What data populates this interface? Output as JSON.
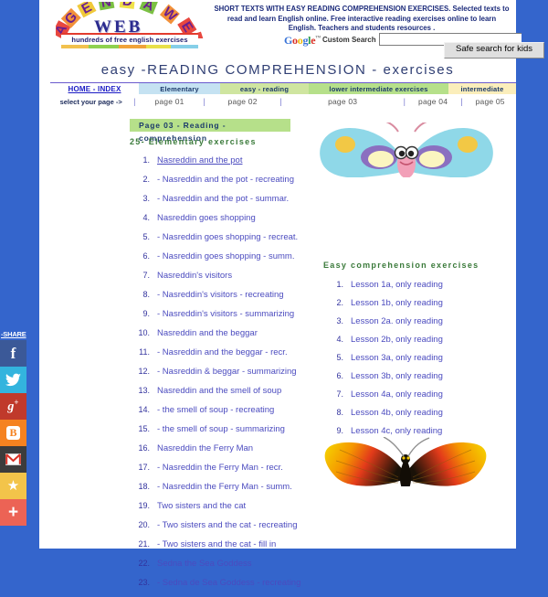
{
  "site": {
    "logo_text": "AGENDA",
    "logo_word": "WEB",
    "logo_tagline": "hundreds of free english exercises"
  },
  "header": {
    "tagline_line1": "SHORT TEXTS WITH EASY READING COMPREHENSION EXERCISES. Selected texts to",
    "tagline_line2": "read and learn English online. Free interactive reading exercises online to learn",
    "tagline_line3": "English. Teachers and students resources .",
    "google_custom_search": "Custom Search",
    "search_value": "",
    "search_placeholder": "",
    "safe_search_button": "Safe search for kids"
  },
  "page_title": "easy -READING COMPREHENSION - exercises",
  "nav": {
    "home_link": "HOME - INDEX",
    "select_label": "select your page ->",
    "separator": "|",
    "tabs": [
      {
        "label": "Elementary",
        "color": "#c5e2f2"
      },
      {
        "label": "easy - reading",
        "color": "#cfe5a0"
      },
      {
        "label": "lower intermediate exercises",
        "color": "#b6e08a"
      },
      {
        "label": "intermediate",
        "color": "#fbeebb"
      }
    ],
    "pages": [
      {
        "label": "page 01"
      },
      {
        "label": "page 02"
      },
      {
        "label": "page 03"
      },
      {
        "label": "page 04"
      },
      {
        "label": "page 05"
      }
    ]
  },
  "page_badge": "Page 03 - Reading - comprehension",
  "left_column": {
    "heading": "25- Elementary exercises",
    "items": [
      {
        "num": "1.",
        "label": "Nasreddin and the pot",
        "visited": true
      },
      {
        "num": "2.",
        "label": "- Nasreddin and the pot - recreating"
      },
      {
        "num": "3.",
        "label": "- Nasreddin and the pot - summar."
      },
      {
        "num": "4.",
        "label": "Nasreddin goes shopping"
      },
      {
        "num": "5.",
        "label": "- Nasreddin goes shopping - recreat."
      },
      {
        "num": "6.",
        "label": "- Nasreddin goes shopping - summ."
      },
      {
        "num": "7.",
        "label": "Nasreddin's visitors"
      },
      {
        "num": "8.",
        "label": "- Nasreddin's visitors - recreating"
      },
      {
        "num": "9.",
        "label": "- Nasreddin's visitors - summarizing"
      },
      {
        "num": "10.",
        "label": "Nasreddin and the beggar"
      },
      {
        "num": "11.",
        "label": "- Nasreddin and the beggar - recr."
      },
      {
        "num": "12.",
        "label": "- Nasreddin & beggar - summarizing"
      },
      {
        "num": "13.",
        "label": "Nasreddin and the smell of soup"
      },
      {
        "num": "14.",
        "label": "- the smell of soup - recreating"
      },
      {
        "num": "15.",
        "label": "- the smell of soup - summarizing"
      },
      {
        "num": "16.",
        "label": "Nasreddin the Ferry Man"
      },
      {
        "num": "17.",
        "label": "- Nasreddin the Ferry Man - recr."
      },
      {
        "num": "18.",
        "label": "- Nasreddin the Ferry Man - summ."
      },
      {
        "num": "19.",
        "label": "Two sisters and the cat"
      },
      {
        "num": "20.",
        "label": "- Two sisters and the cat - recreating"
      },
      {
        "num": "21.",
        "label": "- Two sisters and the cat - fill in"
      },
      {
        "num": "22.",
        "label": "Sedna the Sea Goddess"
      },
      {
        "num": "23.",
        "label": "- Sedna de Sea Goddess - recreating"
      }
    ]
  },
  "right_column": {
    "heading": "Easy comprehension exercises",
    "items": [
      {
        "num": "1.",
        "label": "Lesson 1a, only reading"
      },
      {
        "num": "2.",
        "label": "Lesson 1b, only reading"
      },
      {
        "num": "3.",
        "label": "Lesson 2a. only reading"
      },
      {
        "num": "4.",
        "label": "Lesson 2b, only reading"
      },
      {
        "num": "5.",
        "label": "Lesson 3a, only reading"
      },
      {
        "num": "6.",
        "label": "Lesson 3b, only reading"
      },
      {
        "num": "7.",
        "label": "Lesson 4a, only reading"
      },
      {
        "num": "8.",
        "label": "Lesson 4b, only reading"
      },
      {
        "num": "9.",
        "label": "Lesson 4c, only reading"
      }
    ]
  },
  "share": {
    "label": "-SHARE",
    "buttons": [
      {
        "name": "facebook",
        "glyph": "f",
        "color": "#3b5998"
      },
      {
        "name": "twitter",
        "glyph": "",
        "color": "#33b4de"
      },
      {
        "name": "google-plus",
        "glyph": "g+",
        "color": "#c0392b"
      },
      {
        "name": "blogger",
        "glyph": "B",
        "color": "#f58220"
      },
      {
        "name": "gmail",
        "glyph": "",
        "color": "#3c3c3c"
      },
      {
        "name": "favorite",
        "glyph": "★",
        "color": "#f3c44a"
      },
      {
        "name": "more",
        "glyph": "+",
        "color": "#ec6355"
      }
    ]
  },
  "colors": {
    "page_background": "#3465CC",
    "content_background": "#ffffff",
    "link": "#4b4bbf",
    "heading_green": "#3a7a3a",
    "title": "#2f3e73"
  }
}
